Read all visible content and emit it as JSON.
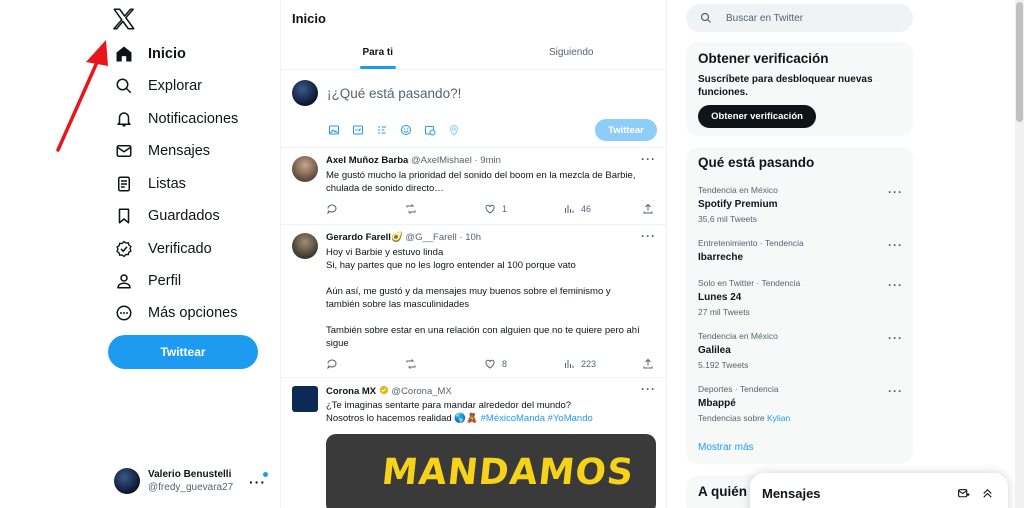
{
  "sidebar": {
    "logo_icon": "x-logo-icon",
    "nav": [
      {
        "label": "Inicio",
        "icon": "home-icon",
        "active": true
      },
      {
        "label": "Explorar",
        "icon": "search-icon"
      },
      {
        "label": "Notificaciones",
        "icon": "bell-icon"
      },
      {
        "label": "Mensajes",
        "icon": "envelope-icon"
      },
      {
        "label": "Listas",
        "icon": "list-icon"
      },
      {
        "label": "Guardados",
        "icon": "bookmark-icon"
      },
      {
        "label": "Verificado",
        "icon": "verified-icon"
      },
      {
        "label": "Perfil",
        "icon": "person-icon"
      },
      {
        "label": "Más opciones",
        "icon": "more-circle-icon"
      }
    ],
    "tweet_button": "Twittear",
    "profile": {
      "name": "Valerio Benustelli",
      "handle": "@fredy_guevara27",
      "more": "···"
    }
  },
  "main": {
    "title": "Inicio",
    "tabs": [
      {
        "label": "Para ti",
        "active": true
      },
      {
        "label": "Siguiendo"
      }
    ],
    "composer": {
      "placeholder": "¡¿Qué está pasando?!",
      "post_button": "Twittear"
    },
    "tweets": [
      {
        "name": "Axel Muñoz Barba",
        "handle": "@AxelMishael",
        "time": "· 9min",
        "lines": [
          "Me gustó mucho la prioridad del sonido del boom en la mezcla de Barbie,",
          "chulada de sonido directo…"
        ],
        "replies": "",
        "retweets": "",
        "likes": "1",
        "views": "46"
      },
      {
        "name": "Gerardo Farell🥑",
        "handle": "@G__Farell",
        "time": "· 10h",
        "lines": [
          "Hoy vi Barbie y estuvo linda",
          "Si, hay partes que no les logro entender al 100 porque vato",
          "",
          "Aún así, me gustó y da mensajes muy buenos sobre el feminismo y",
          "también sobre las masculinidades",
          "",
          "También sobre estar en una relación con alguien que no te quiere pero ahí",
          "sigue"
        ],
        "replies": "",
        "retweets": "",
        "likes": "8",
        "views": "223"
      },
      {
        "name": "Corona MX",
        "handle": "@Corona_MX",
        "time": "",
        "lines": [
          "¿Te imaginas sentarte para mandar alrededor del mundo?"
        ],
        "line2_text": "Nosotros lo hacemos realidad 🌎🧸",
        "hashtags": "#MéxicoManda #YoMando",
        "media_text": "MANDAMOS"
      }
    ]
  },
  "right": {
    "search_placeholder": "Buscar en Twitter",
    "verify": {
      "title": "Obtener verificación",
      "text": "Suscríbete para desbloquear nuevas funciones.",
      "button": "Obtener verificación"
    },
    "trends_title": "Qué está pasando",
    "trends": [
      {
        "category": "Tendencia en México",
        "name": "Spotify Premium",
        "count": "35,6 mil Tweets"
      },
      {
        "category": "Entretenimiento · Tendencia",
        "name": "Ibarreche",
        "count": ""
      },
      {
        "category": "Solo en Twitter · Tendencia",
        "name": "Lunes 24",
        "count": "27 mil Tweets"
      },
      {
        "category": "Tendencia en México",
        "name": "Galilea",
        "count": "5.192 Tweets"
      },
      {
        "category": "Deportes · Tendencia",
        "name": "Mbappé",
        "count_prefix": "Tendencias sobre",
        "count_link": "Kylian"
      }
    ],
    "show_more": "Mostrar más",
    "who_to_follow": "A quién s"
  },
  "messages_drawer": {
    "title": "Mensajes"
  },
  "colors": {
    "accent": "#1d9bf0",
    "arrow": "#e8161b"
  }
}
